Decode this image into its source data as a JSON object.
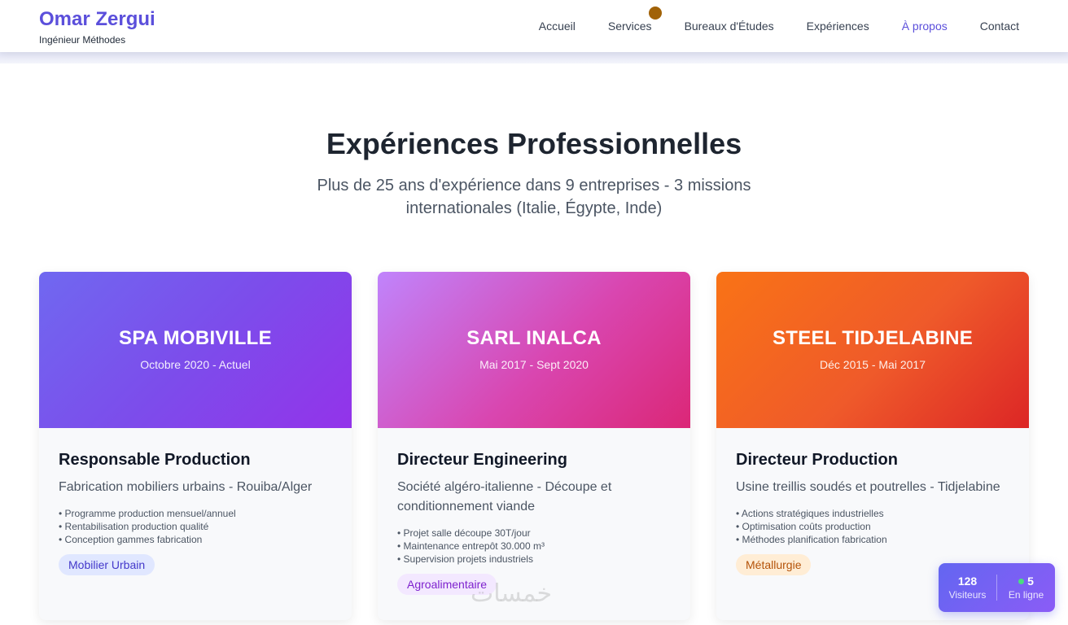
{
  "brand": {
    "name": "Omar Zergui",
    "role": "Ingénieur Méthodes"
  },
  "nav": [
    {
      "label": "Accueil"
    },
    {
      "label": "Services"
    },
    {
      "label": "Bureaux d'Études"
    },
    {
      "label": "Expériences"
    },
    {
      "label": "À propos"
    },
    {
      "label": "Contact"
    }
  ],
  "section": {
    "title": "Expériences Professionnelles",
    "subtitle": "Plus de 25 ans d'expérience dans 9 entreprises - 3 missions internationales (Italie, Égypte, Inde)"
  },
  "cards": [
    {
      "company": "SPA MOBIVILLE",
      "period": "Octobre 2020 - Actuel",
      "role": "Responsable Production",
      "description": "Fabrication mobiliers urbains - Rouiba/Alger",
      "bullets": [
        "• Programme production mensuel/annuel",
        "• Rentabilisation production qualité",
        "• Conception gammes fabrication"
      ],
      "tag": "Mobilier Urbain"
    },
    {
      "company": "SARL INALCA",
      "period": "Mai 2017 - Sept 2020",
      "role": "Directeur Engineering",
      "description": "Société algéro-italienne - Découpe et conditionnement viande",
      "bullets": [
        "• Projet salle découpe 30T/jour",
        "• Maintenance entrepôt 30.000 m³",
        "• Supervision projets industriels"
      ],
      "tag": "Agroalimentaire"
    },
    {
      "company": "STEEL TIDJELABINE",
      "period": "Déc 2015 - Mai 2017",
      "role": "Directeur Production",
      "description": "Usine treillis soudés et poutrelles - Tidjelabine",
      "bullets": [
        "• Actions stratégiques industrielles",
        "• Optimisation coûts production",
        "• Méthodes planification fabrication"
      ],
      "tag": "Métallurgie"
    }
  ],
  "watermark": "خمسات",
  "stats": {
    "visitors": {
      "value": "128",
      "label": "Visiteurs"
    },
    "online": {
      "value": "5",
      "label": "En ligne"
    }
  }
}
